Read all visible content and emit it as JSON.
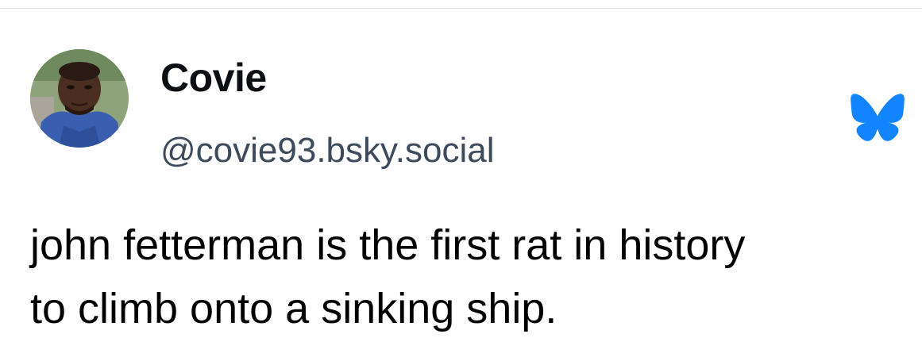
{
  "post": {
    "author": {
      "display_name": "Covie",
      "handle": "@covie93.bsky.social",
      "avatar_icon": "user-avatar-photo"
    },
    "platform_icon": "bluesky-butterfly-icon",
    "accent_color": "#1185fe",
    "text_lines": [
      "john fetterman is the first rat in history",
      "to climb onto a sinking ship."
    ]
  }
}
